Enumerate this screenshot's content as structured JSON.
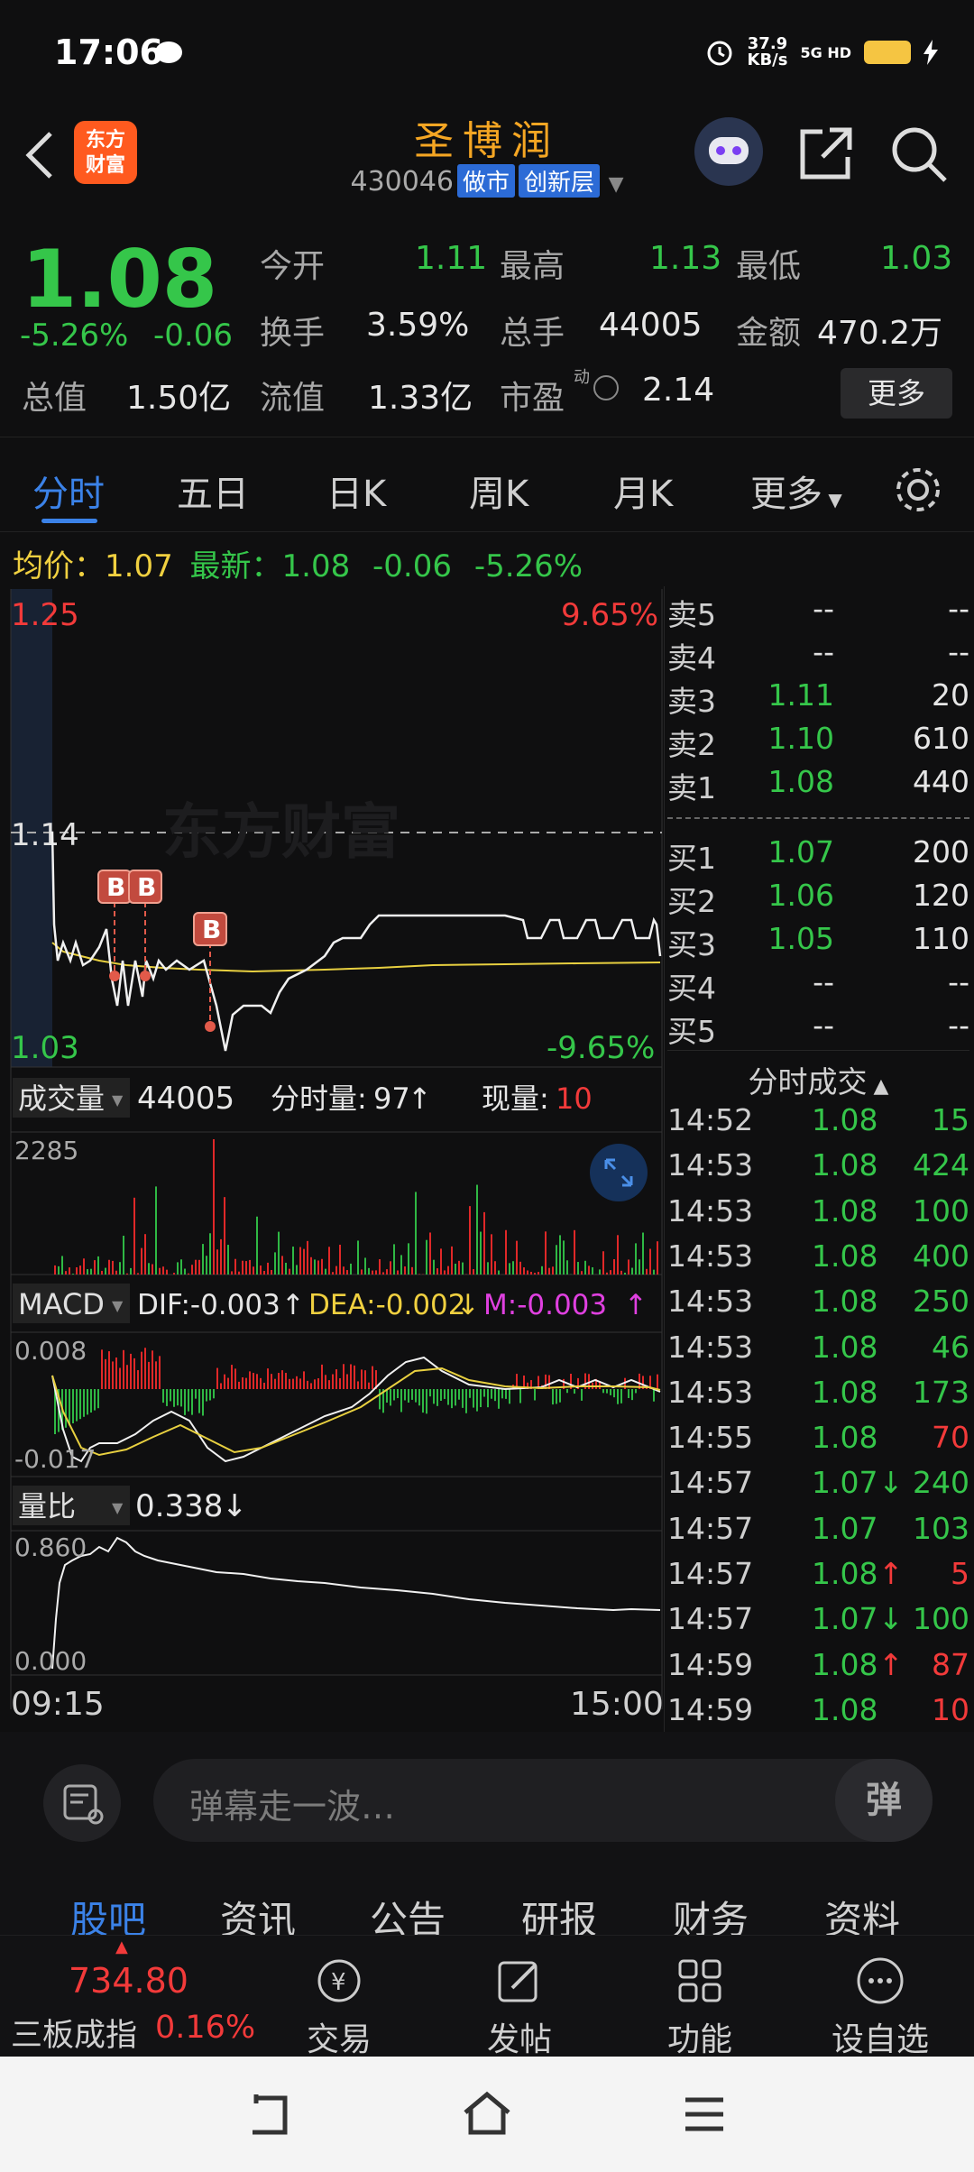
{
  "status": {
    "time": "17:06",
    "net_speed": "37.9",
    "net_unit": "KB/s",
    "net_type": "5G HD"
  },
  "header": {
    "logo_line1": "东方",
    "logo_line2": "财富",
    "stock_name": "圣博润",
    "code": "430046",
    "tag1": "做市",
    "tag2": "创新层"
  },
  "quote": {
    "price": "1.08",
    "change_pct": "-5.26%",
    "change": "-0.06",
    "open_label": "今开",
    "open": "1.11",
    "high_label": "最高",
    "high": "1.13",
    "low_label": "最低",
    "low": "1.03",
    "turnover_label": "换手",
    "turnover": "3.59%",
    "volume_label": "总手",
    "volume": "44005",
    "amount_label": "金额",
    "amount": "470.2万",
    "mktcap_label": "总值",
    "mktcap": "1.50亿",
    "float_label": "流值",
    "float": "1.33亿",
    "pe_label": "市盈",
    "pe_sup": "动",
    "pe": "2.14",
    "more_btn": "更多"
  },
  "tabs": [
    "分时",
    "五日",
    "日K",
    "周K",
    "月K",
    "更多"
  ],
  "intraday": {
    "avg_label": "均价：",
    "avg": "1.07",
    "latest_label": "最新：",
    "latest": "1.08",
    "latest_chg": "-0.06",
    "latest_pct": "-5.26%",
    "top_price": "1.25",
    "top_pct": "9.65%",
    "mid_price": "1.14",
    "bottom_price": "1.03",
    "bottom_pct": "-9.65%",
    "watermark": "东方财富",
    "buy_marker": "B",
    "vol_label": "成交量",
    "vol_total": "44005",
    "vol_tick_label": "分时量:",
    "vol_tick": "97",
    "vol_now_label": "现量:",
    "vol_now": "10",
    "vol_max": "2285",
    "macd_label": "MACD",
    "dif": "DIF:-0.003",
    "dea": "DEA:-0.002",
    "m": "M:-0.003",
    "macd_top": "0.008",
    "macd_bottom": "-0.017",
    "ratio_label": "量比",
    "ratio": "0.338",
    "ratio_top": "0.860",
    "ratio_bottom": "0.000",
    "time_start": "09:15",
    "time_end": "15:00"
  },
  "orderbook": {
    "asks": [
      {
        "label": "卖5",
        "price": "--",
        "vol": "--"
      },
      {
        "label": "卖4",
        "price": "--",
        "vol": "--"
      },
      {
        "label": "卖3",
        "price": "1.11",
        "vol": "20"
      },
      {
        "label": "卖2",
        "price": "1.10",
        "vol": "610"
      },
      {
        "label": "卖1",
        "price": "1.08",
        "vol": "440"
      }
    ],
    "bids": [
      {
        "label": "买1",
        "price": "1.07",
        "vol": "200"
      },
      {
        "label": "买2",
        "price": "1.06",
        "vol": "120"
      },
      {
        "label": "买3",
        "price": "1.05",
        "vol": "110"
      },
      {
        "label": "买4",
        "price": "--",
        "vol": "--"
      },
      {
        "label": "买5",
        "price": "--",
        "vol": "--"
      }
    ]
  },
  "ticks": {
    "header": "分时成交",
    "rows": [
      {
        "time": "14:52",
        "price": "1.08",
        "vol": "15",
        "dir": "",
        "vcolor": "green"
      },
      {
        "time": "14:53",
        "price": "1.08",
        "vol": "424",
        "dir": "",
        "vcolor": "green"
      },
      {
        "time": "14:53",
        "price": "1.08",
        "vol": "100",
        "dir": "",
        "vcolor": "green"
      },
      {
        "time": "14:53",
        "price": "1.08",
        "vol": "400",
        "dir": "",
        "vcolor": "green"
      },
      {
        "time": "14:53",
        "price": "1.08",
        "vol": "250",
        "dir": "",
        "vcolor": "green"
      },
      {
        "time": "14:53",
        "price": "1.08",
        "vol": "46",
        "dir": "",
        "vcolor": "green"
      },
      {
        "time": "14:53",
        "price": "1.08",
        "vol": "173",
        "dir": "",
        "vcolor": "green"
      },
      {
        "time": "14:55",
        "price": "1.08",
        "vol": "70",
        "dir": "",
        "vcolor": "red"
      },
      {
        "time": "14:57",
        "price": "1.07",
        "vol": "240",
        "dir": "↓",
        "vcolor": "green"
      },
      {
        "time": "14:57",
        "price": "1.07",
        "vol": "103",
        "dir": "",
        "vcolor": "green"
      },
      {
        "time": "14:57",
        "price": "1.08",
        "vol": "5",
        "dir": "↑",
        "vcolor": "red"
      },
      {
        "time": "14:57",
        "price": "1.07",
        "vol": "100",
        "dir": "↓",
        "vcolor": "green"
      },
      {
        "time": "14:59",
        "price": "1.08",
        "vol": "87",
        "dir": "↑",
        "vcolor": "red"
      },
      {
        "time": "14:59",
        "price": "1.08",
        "vol": "10",
        "dir": "",
        "vcolor": "red"
      }
    ]
  },
  "input": {
    "placeholder": "弹幕走一波…",
    "danmu_btn": "弹"
  },
  "subtabs": [
    "股吧",
    "资讯",
    "公告",
    "研报",
    "财务",
    "资料"
  ],
  "bottomnav": {
    "index_value": "734.80",
    "index_name": "三板成指",
    "index_pct": "0.16%",
    "items": [
      "交易",
      "发帖",
      "功能",
      "设自选"
    ]
  },
  "colors": {
    "up": "#f23a3a",
    "down": "#35c64a",
    "accent": "#3b82e8",
    "avg": "#f0d040"
  }
}
